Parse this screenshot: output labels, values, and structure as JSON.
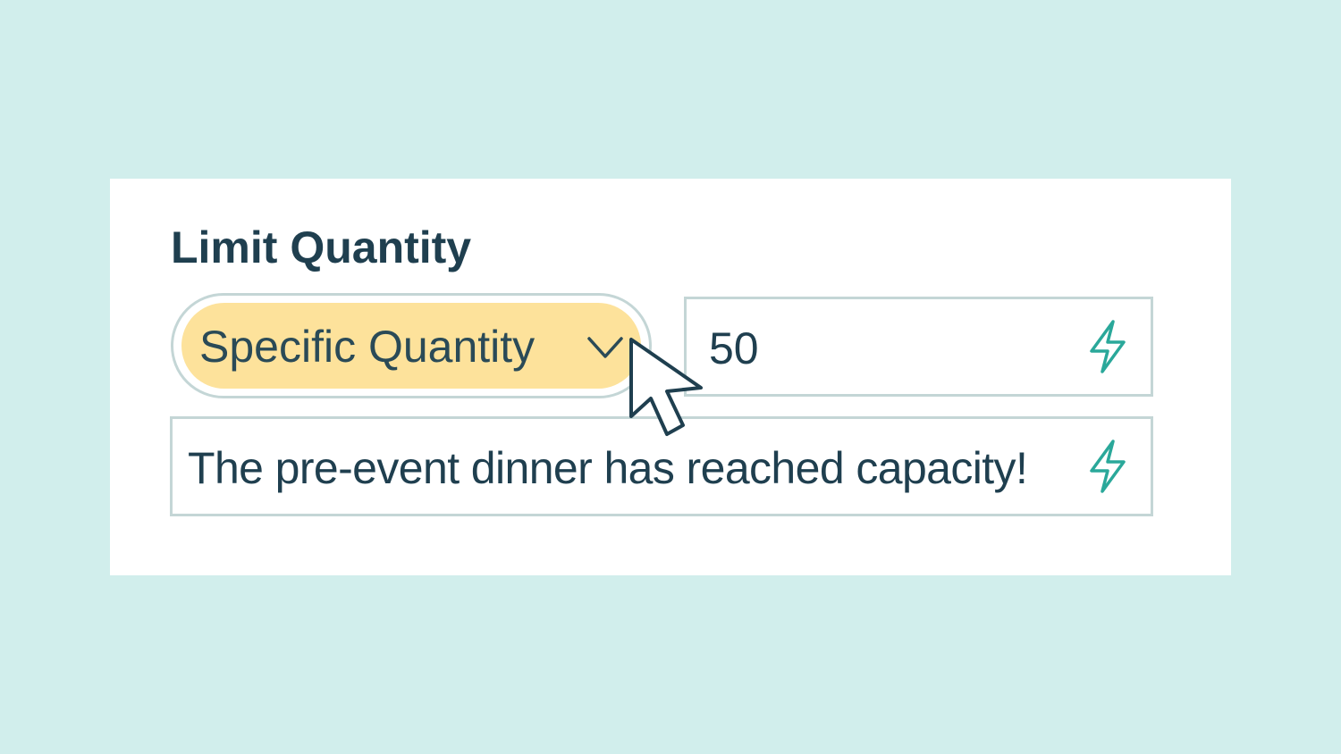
{
  "limit_quantity": {
    "title": "Limit Quantity",
    "select": {
      "selected_label": "Specific Quantity",
      "icon": "chevron-down-icon"
    },
    "quantity_input": {
      "value": "50",
      "icon": "lightning-bolt-icon"
    },
    "message_input": {
      "value": "The pre-event dinner has reached capacity!",
      "icon": "lightning-bolt-icon"
    }
  },
  "colors": {
    "background": "#d1eeec",
    "select_highlight": "#fde29b",
    "text": "#1f3f4f",
    "accent": "#2aa89a",
    "field_border": "#c4d6d6"
  },
  "cursor": {
    "icon": "mouse-pointer-icon"
  }
}
